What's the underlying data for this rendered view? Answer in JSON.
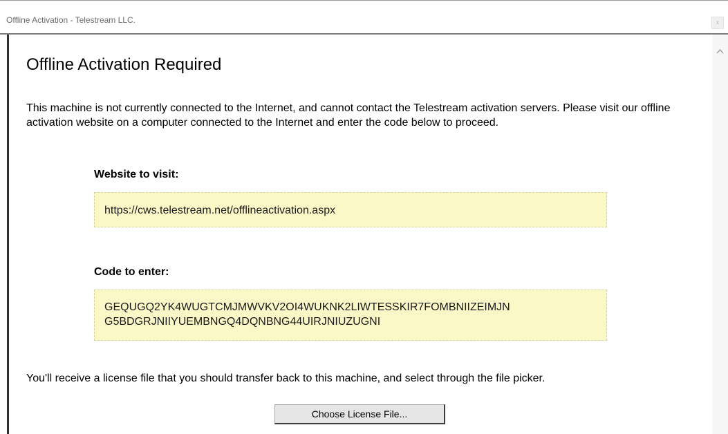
{
  "window": {
    "title": "Offline Activation - Telestream LLC.",
    "close_glyph": "x"
  },
  "content": {
    "heading": "Offline Activation Required",
    "description": "This machine is not currently connected to the Internet, and cannot contact the Telestream activation servers. Please visit our offline activation website on a computer connected to the Internet and enter the code below to proceed.",
    "website_label": "Website to visit:",
    "website_url": "https://cws.telestream.net/offlineactivation.aspx",
    "code_label": "Code to enter:",
    "code_lines": [
      "GEQUGQ2YK4WUGTCMJMWVKV2OI4WUKNK2LIWTESSKIR7FOMBNIIZEIMJN",
      "G5BDGRJNIIYUEMBNGQ4DQNBNG44UIRJNIUZUGNI"
    ],
    "footer_text": "You'll receive a license file that you should transfer back to this machine, and select through the file picker.",
    "choose_button_label": "Choose License File..."
  },
  "icons": {
    "close": "close-icon",
    "scroll_up": "chevron-up-icon"
  },
  "colors": {
    "highlight_box": "#fbf8c8",
    "highlight_border": "#d5d29a",
    "title_text": "#6b6b6b"
  }
}
